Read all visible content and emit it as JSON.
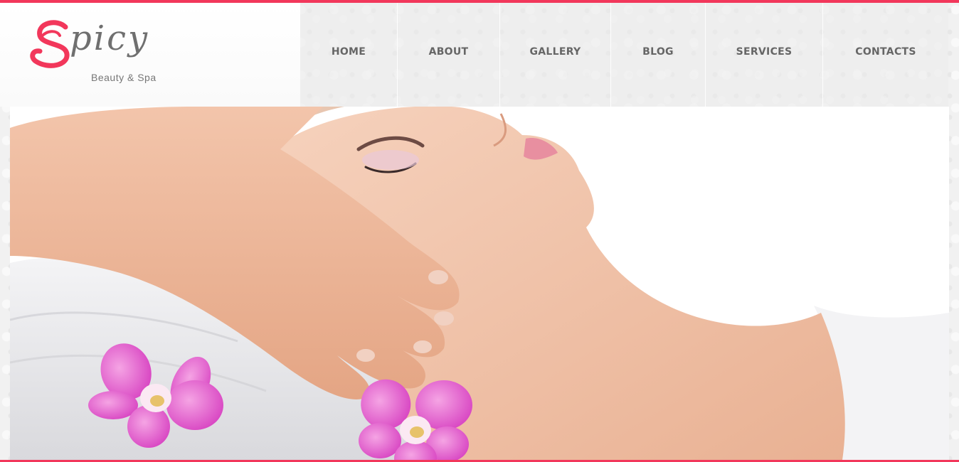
{
  "brand": {
    "name": "picy",
    "initial": "S",
    "tagline": "Beauty & Spa",
    "accent_color": "#f2375b"
  },
  "nav": {
    "items": [
      {
        "label": "HOME"
      },
      {
        "label": "ABOUT"
      },
      {
        "label": "GALLERY"
      },
      {
        "label": "BLOG"
      },
      {
        "label": "SERVICES"
      },
      {
        "label": "CONTACTS"
      }
    ]
  },
  "hero": {
    "image_icon": "spa-massage-photo"
  }
}
